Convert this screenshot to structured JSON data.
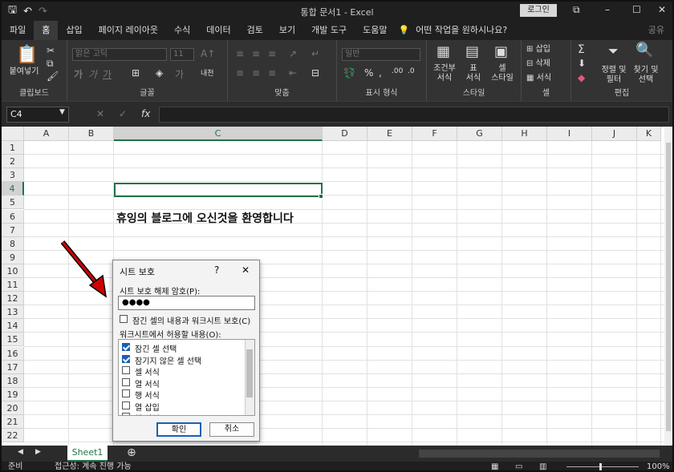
{
  "window": {
    "title": "통합 문서1  -  Excel",
    "login": "로그인"
  },
  "tabs": [
    "파일",
    "홈",
    "삽입",
    "페이지 레이아웃",
    "수식",
    "데이터",
    "검토",
    "보기",
    "개발 도구",
    "도움말"
  ],
  "tell_me": "어떤 작업을 원하시나요?",
  "share": "공유",
  "ribbon": {
    "paste": "붙여넣기",
    "clipboard": "클립보드",
    "font_name": "맑은 고딕",
    "font_size": "11",
    "font_group": "글꼴",
    "align_group": "맞춤",
    "number_format": "일반",
    "number_group": "표시 형식",
    "cond_fmt_1": "조건부",
    "cond_fmt_2": "서식",
    "table_fmt_1": "표",
    "table_fmt_2": "서식",
    "cell_style_1": "셀",
    "cell_style_2": "스타일",
    "style_group": "스타일",
    "insert": "삽입",
    "delete": "삭제",
    "format": "서식",
    "cells_group": "셀",
    "sort_1": "정렬 및",
    "sort_2": "필터",
    "find_1": "찾기 및",
    "find_2": "선택",
    "edit_group": "편집"
  },
  "formula_bar": {
    "name_box": "C4",
    "fx": "fx",
    "cancel": "✕",
    "enter": "✓",
    "value": ""
  },
  "columns": [
    "A",
    "B",
    "C",
    "D",
    "E",
    "F",
    "G",
    "H",
    "I",
    "J",
    "K"
  ],
  "rows": [
    "1",
    "2",
    "3",
    "4",
    "5",
    "6",
    "7",
    "8",
    "9",
    "10",
    "11",
    "12",
    "13",
    "14",
    "15",
    "16",
    "17",
    "18",
    "19",
    "20",
    "21",
    "22"
  ],
  "cell_c6": "휴잉의 블로그에 오신것을 환영합니다",
  "sheet_tab": "Sheet1",
  "status": {
    "ready": "준비",
    "accessibility": "접근성: 계속 진행 가능",
    "zoom": "100%"
  },
  "dialog": {
    "title": "시트 보호",
    "help": "?",
    "close": "✕",
    "pwd_label": "시트 보호 해제 암호(P):",
    "pwd_value": "●●●●",
    "protect_label": "잠긴 셀의 내용과 워크시트 보호(C)",
    "allow_label": "워크시트에서 허용할 내용(O):",
    "items": [
      {
        "label": "잠긴 셀 선택",
        "checked": true
      },
      {
        "label": "잠기지 않은 셀 선택",
        "checked": true
      },
      {
        "label": "셀 서식",
        "checked": false
      },
      {
        "label": "열 서식",
        "checked": false
      },
      {
        "label": "행 서식",
        "checked": false
      },
      {
        "label": "열 삽입",
        "checked": false
      },
      {
        "label": "행 삽입",
        "checked": false
      }
    ],
    "ok": "확인",
    "cancel": "취소"
  },
  "colors": {
    "accent": "#217346",
    "checkbox": "#1a5fb4",
    "arrow": "#d40000"
  }
}
